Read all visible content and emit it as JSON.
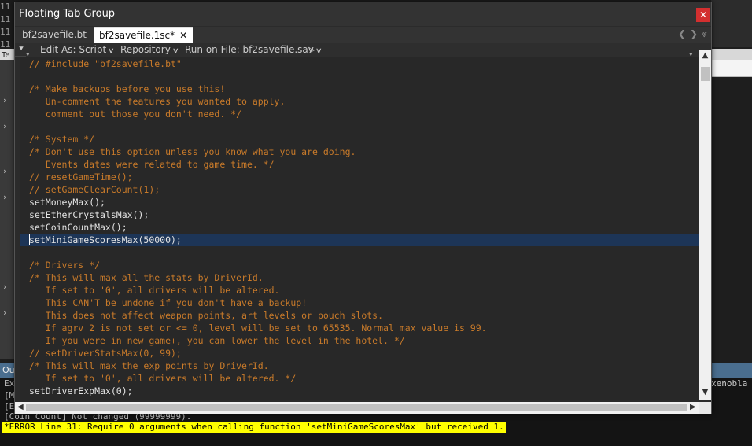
{
  "window": {
    "title": "Floating Tab Group",
    "close_glyph": "✕"
  },
  "tabs": [
    {
      "label": "bf2savefile.bt",
      "active": false
    },
    {
      "label": "bf2savefile.1sc*",
      "active": true,
      "close_glyph": "✕"
    }
  ],
  "tab_nav": {
    "prev": "❮",
    "next": "❯",
    "menu": "⩔"
  },
  "toolbar": {
    "pin": "⯆",
    "edit_as": "Edit As: Script",
    "repository": "Repository",
    "run_on_file": "Run on File: bf2savefile.sav",
    "run_arrow": "▷",
    "chevron": "∨"
  },
  "code_lines": [
    {
      "text": "// #include \"bf2savefile.bt\"",
      "kind": "comment"
    },
    {
      "text": "",
      "kind": "code"
    },
    {
      "text": "/* Make backups before you use this!",
      "kind": "comment"
    },
    {
      "text": "   Un-comment the features you wanted to apply,",
      "kind": "comment"
    },
    {
      "text": "   comment out those you don't need. */",
      "kind": "comment"
    },
    {
      "text": "",
      "kind": "code"
    },
    {
      "text": "/* System */",
      "kind": "comment"
    },
    {
      "text": "/* Don't use this option unless you know what you are doing.",
      "kind": "comment"
    },
    {
      "text": "   Events dates were related to game time. */",
      "kind": "comment"
    },
    {
      "text": "// resetGameTime();",
      "kind": "comment"
    },
    {
      "text": "// setGameClearCount(1);",
      "kind": "comment"
    },
    {
      "text": "setMoneyMax();",
      "kind": "code"
    },
    {
      "text": "setEtherCrystalsMax();",
      "kind": "code"
    },
    {
      "text": "setCoinCountMax();",
      "kind": "code"
    },
    {
      "text": "setMiniGameScoresMax(50000);",
      "kind": "code"
    },
    {
      "text": "",
      "kind": "code"
    },
    {
      "text": "/* Drivers */",
      "kind": "comment"
    },
    {
      "text": "/* This will max all the stats by DriverId.",
      "kind": "comment"
    },
    {
      "text": "   If set to '0', all drivers will be altered.",
      "kind": "comment"
    },
    {
      "text": "   This CAN'T be undone if you don't have a backup!",
      "kind": "comment"
    },
    {
      "text": "   This does not affect weapon points, art levels or pouch slots.",
      "kind": "comment"
    },
    {
      "text": "   If agrv 2 is not set or <= 0, level will be set to 65535. Normal max value is 99.",
      "kind": "comment"
    },
    {
      "text": "   If you were in new game+, you can lower the level in the hotel. */",
      "kind": "comment"
    },
    {
      "text": "// setDriverStatsMax(0, 99);",
      "kind": "comment"
    },
    {
      "text": "/* This will max the exp points by DriverId.",
      "kind": "comment"
    },
    {
      "text": "   If set to '0', all drivers will be altered. */",
      "kind": "comment"
    },
    {
      "text": "setDriverExpMax(0);",
      "kind": "code"
    }
  ],
  "background": {
    "top_left_lines": [
      "11",
      "11",
      "11",
      "11"
    ],
    "tiny_label": "Te",
    "output_label": "Ou",
    "right_text": "xenobla",
    "output_lines": [
      "Ex",
      "[M",
      "[E",
      "[Coin Count] Not changed (99999999)."
    ]
  },
  "error_message": "*ERROR Line 31: Require 0 arguments when calling function 'setMiniGameScoresMax' but received 1."
}
